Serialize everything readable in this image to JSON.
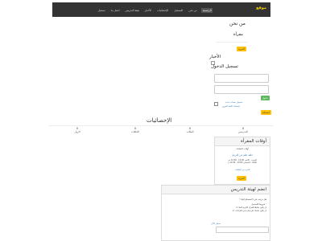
{
  "brand": "موقع",
  "nav_items": [
    "الرئيسية",
    "من نحن",
    "التسجيل",
    "الإحصائيات",
    "الأخبار",
    "هيئة التدريس",
    "اتصل بنا",
    "تسجيل"
  ],
  "about": {
    "title": "من نحن",
    "subtitle": "مقرأة",
    "button": "المزيد"
  },
  "news": {
    "title": "الأخبار"
  },
  "login": {
    "title": "تسجيل الدخول",
    "remember": "تذكرني",
    "submit": "دخول",
    "register_link": "تسجيل حساب جديد",
    "forgot_link": "استعادة كلمة المرور",
    "join_button": "انضمام"
  },
  "stats": {
    "title": "الإحصائيات",
    "items": [
      {
        "value": "0",
        "label": "المدرسين"
      },
      {
        "value": "0",
        "label": "الطلاب"
      },
      {
        "value": "0",
        "label": "الحلقات"
      },
      {
        "value": "0",
        "label": "الزوار"
      }
    ]
  },
  "times_panel": {
    "title": "أوقات المقرأة",
    "subtitle": "أوقات الحلقات",
    "link": "حلقة تعلم فن الترتيل",
    "lines": [
      "السبت - الاثنين 10:00 - 12:00 ص",
      "الثلاثاء - الخميس 10:00 - 12:00 م"
    ],
    "more": "المزيد من الحلقات",
    "button": "المزيد"
  },
  "join_panel": {
    "title": "انضم لهيئة التدريس",
    "question": "هل ترغب في الانضمام إلينا ؟",
    "requirements_title": "شروط التسجيل :",
    "req1": "1- أن يكون حافظا للقرآن الكريم كاملا",
    "req2": "2- أن يكون حاصلا على إجازة في القراءات",
    "link": "سجل الآن"
  }
}
